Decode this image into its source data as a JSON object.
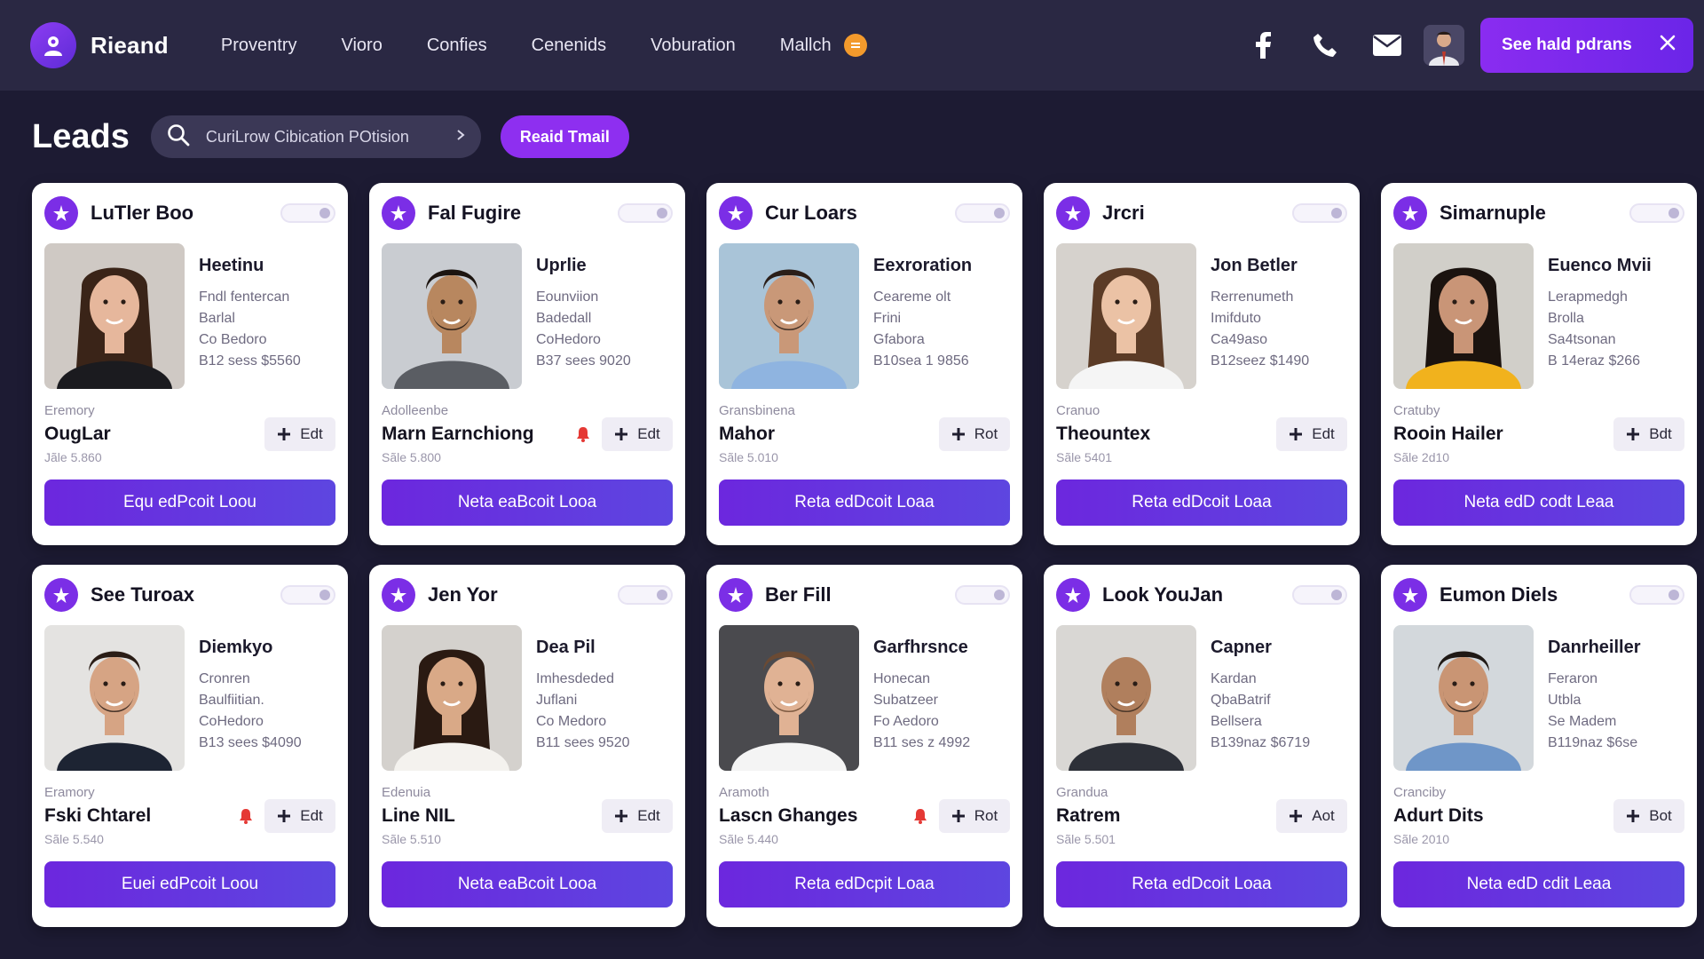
{
  "brand": {
    "name": "Rieand"
  },
  "nav": {
    "items": [
      "Proventry",
      "Vioro",
      "Confies",
      "Cenenids",
      "Voburation",
      "Mallch"
    ],
    "badge_color": "#f39a2c",
    "icons": [
      "facebook-icon",
      "phone-icon",
      "mail-icon",
      "user-avatar"
    ]
  },
  "cta": {
    "label": "See hald pdrans"
  },
  "header": {
    "title": "Leads",
    "search_value": "CuriLrow Cibication POtision",
    "action_label": "Reaid Tmail"
  },
  "colors": {
    "accent": "#7b2ee6",
    "background": "#1d1b33",
    "topbar": "#2a2843",
    "card": "#ffffff"
  },
  "cards": [
    {
      "name": "LuTler Boo",
      "title": "Heetinu",
      "lines": [
        "Fndl fentercan",
        "Barlal",
        "Co Bedoro",
        "B12 sess $5560"
      ],
      "company_label": "Eremory",
      "company": "OugLar",
      "company_sub": "Jãle 5.860",
      "alert": false,
      "action": "Edt",
      "button": "Equ edPcoit Loou",
      "photo": "p1"
    },
    {
      "name": "Fal Fugire",
      "title": "Uprlie",
      "lines": [
        "Eounviion",
        "Badedall",
        "CoHedoro",
        "B37 sees 9020"
      ],
      "company_label": "Adolleenbe",
      "company": "Marn Earnchiong",
      "company_sub": "Sãle 5.800",
      "alert": true,
      "action": "Edt",
      "button": "Neta eaBcoit Looa",
      "photo": "p2"
    },
    {
      "name": "Cur Loars",
      "title": "Eexroration",
      "lines": [
        "Ceareme olt",
        "Frini",
        "Gfabora",
        "B10sea 1 9856"
      ],
      "company_label": "Gransbinena",
      "company": "Mahor",
      "company_sub": "Sãle 5.010",
      "alert": false,
      "action": "Rot",
      "button": "Reta edDcoit Loaa",
      "photo": "p3"
    },
    {
      "name": "Jrcri",
      "title": "Jon Betler",
      "lines": [
        "Rerrenumeth",
        "Imifduto",
        "Ca49aso",
        "B12seez $1490"
      ],
      "company_label": "Cranuo",
      "company": "Theountex",
      "company_sub": "Sãle 5401",
      "alert": false,
      "action": "Edt",
      "button": "Reta edDcoit Loaa",
      "photo": "p4"
    },
    {
      "name": "Simarnuple",
      "title": "Euenco Mvii",
      "lines": [
        "Lerapmedgh",
        "Brolla",
        "Sa4tsonan",
        "B 14eraz $266"
      ],
      "company_label": "Cratuby",
      "company": "Rooin Hailer",
      "company_sub": "Sãle 2d10",
      "alert": false,
      "action": "Bdt",
      "button": "Neta edD codt Leaa",
      "photo": "p5"
    },
    {
      "name": "See Turoax",
      "title": "Diemkyo",
      "lines": [
        "Cronren",
        "Baulfiitian.",
        "CoHedoro",
        "B13 sees $4090"
      ],
      "company_label": "Eramory",
      "company": "Fski Chtarel",
      "company_sub": "Sãle 5.540",
      "alert": true,
      "action": "Edt",
      "button": "Euei edPcoit Loou",
      "photo": "p6"
    },
    {
      "name": "Jen Yor",
      "title": "Dea Pil",
      "lines": [
        "Imhesdeded",
        "Juflani",
        "Co Medoro",
        "B11 sees 9520"
      ],
      "company_label": "Edenuia",
      "company": "Line NIL",
      "company_sub": "Sãle 5.510",
      "alert": false,
      "action": "Edt",
      "button": "Neta eaBcoit Looa",
      "photo": "p7"
    },
    {
      "name": "Ber Fill",
      "title": "Garfhrsnce",
      "lines": [
        "Honecan",
        "Subatzeer",
        "Fo Aedoro",
        "B11 ses z 4992"
      ],
      "company_label": "Aramoth",
      "company": "Lascn Ghanges",
      "company_sub": "Sãle 5.440",
      "alert": true,
      "action": "Rot",
      "button": "Reta edDcpit Loaa",
      "photo": "p8"
    },
    {
      "name": "Look YouJan",
      "title": "Capner",
      "lines": [
        "Kardan",
        "QbaBatrif",
        "Bellsera",
        "B139naz $6719"
      ],
      "company_label": "Grandua",
      "company": "Ratrem",
      "company_sub": "Sãle 5.501",
      "alert": false,
      "action": "Aot",
      "button": "Reta edDcoit Loaa",
      "photo": "p9"
    },
    {
      "name": "Eumon Diels",
      "title": "Danrheiller",
      "lines": [
        "Feraron",
        "Utbla",
        "Se Madem",
        "B119naz $6se"
      ],
      "company_label": "Cranciby",
      "company": "Adurt Dits",
      "company_sub": "Sãle 2010",
      "alert": false,
      "action": "Bot",
      "button": "Neta edD cdit Leaa",
      "photo": "p10"
    }
  ]
}
